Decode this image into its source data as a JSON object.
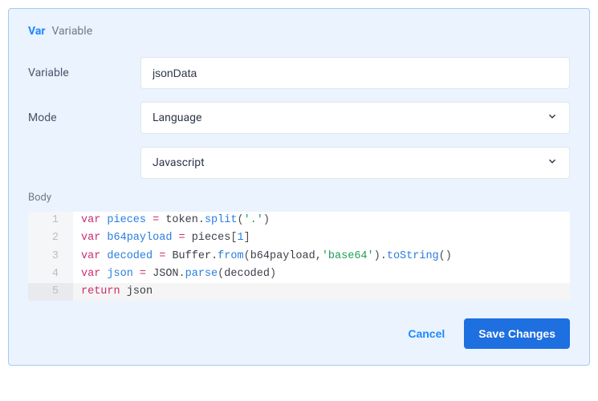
{
  "header": {
    "tag": "Var",
    "title": "Variable"
  },
  "fields": {
    "variable": {
      "label": "Variable",
      "value": "jsonData"
    },
    "mode": {
      "label": "Mode",
      "value": "Language"
    },
    "language": {
      "value": "Javascript"
    },
    "body_label": "Body"
  },
  "code": {
    "lines": [
      {
        "n": "1",
        "tokens": [
          {
            "t": "var ",
            "c": "kw"
          },
          {
            "t": "pieces",
            "c": "var"
          },
          {
            "t": " ",
            "c": "punc"
          },
          {
            "t": "=",
            "c": "op"
          },
          {
            "t": " token",
            "c": "obj"
          },
          {
            "t": ".",
            "c": "punc"
          },
          {
            "t": "split",
            "c": "fn"
          },
          {
            "t": "(",
            "c": "punc"
          },
          {
            "t": "'.'",
            "c": "str"
          },
          {
            "t": ")",
            "c": "punc"
          }
        ]
      },
      {
        "n": "2",
        "tokens": [
          {
            "t": "var ",
            "c": "kw"
          },
          {
            "t": "b64payload",
            "c": "var"
          },
          {
            "t": " ",
            "c": "punc"
          },
          {
            "t": "=",
            "c": "op"
          },
          {
            "t": " pieces",
            "c": "obj"
          },
          {
            "t": "[",
            "c": "punc"
          },
          {
            "t": "1",
            "c": "num"
          },
          {
            "t": "]",
            "c": "punc"
          }
        ]
      },
      {
        "n": "3",
        "tokens": [
          {
            "t": "var ",
            "c": "kw"
          },
          {
            "t": "decoded",
            "c": "var"
          },
          {
            "t": " ",
            "c": "punc"
          },
          {
            "t": "=",
            "c": "op"
          },
          {
            "t": " Buffer",
            "c": "obj"
          },
          {
            "t": ".",
            "c": "punc"
          },
          {
            "t": "from",
            "c": "fn"
          },
          {
            "t": "(",
            "c": "punc"
          },
          {
            "t": "b64payload",
            "c": "obj"
          },
          {
            "t": ",",
            "c": "punc"
          },
          {
            "t": "'base64'",
            "c": "str"
          },
          {
            "t": ")",
            "c": "punc"
          },
          {
            "t": ".",
            "c": "punc"
          },
          {
            "t": "toString",
            "c": "fn"
          },
          {
            "t": "()",
            "c": "punc"
          }
        ]
      },
      {
        "n": "4",
        "tokens": [
          {
            "t": "var ",
            "c": "kw"
          },
          {
            "t": "json",
            "c": "var"
          },
          {
            "t": " ",
            "c": "punc"
          },
          {
            "t": "=",
            "c": "op"
          },
          {
            "t": " JSON",
            "c": "obj"
          },
          {
            "t": ".",
            "c": "punc"
          },
          {
            "t": "parse",
            "c": "fn"
          },
          {
            "t": "(",
            "c": "punc"
          },
          {
            "t": "decoded",
            "c": "obj"
          },
          {
            "t": ")",
            "c": "punc"
          }
        ]
      },
      {
        "n": "5",
        "active": true,
        "tokens": [
          {
            "t": "return ",
            "c": "kw"
          },
          {
            "t": "json",
            "c": "obj"
          }
        ]
      }
    ]
  },
  "actions": {
    "cancel": "Cancel",
    "save": "Save Changes"
  }
}
